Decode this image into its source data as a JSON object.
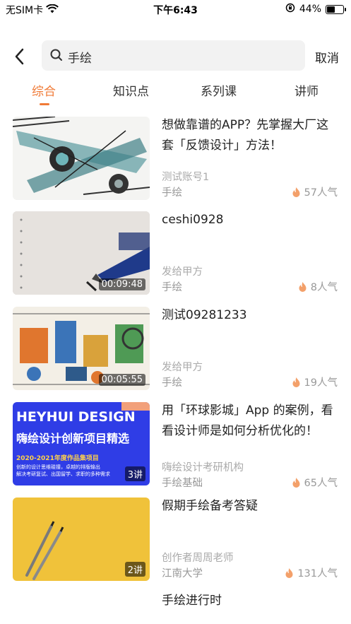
{
  "status_bar": {
    "carrier": "无SIM卡",
    "time": "下午6:43",
    "battery": "44%"
  },
  "search": {
    "query": "手绘",
    "cancel_label": "取消"
  },
  "tabs": [
    {
      "label": "综合",
      "active": true
    },
    {
      "label": "知识点",
      "active": false
    },
    {
      "label": "系列课",
      "active": false
    },
    {
      "label": "讲师",
      "active": false
    }
  ],
  "items": [
    {
      "title": "想做靠谱的APP？先掌握大厂这套「反馈设计」方法！",
      "author": "测试账号1",
      "tag": "手绘",
      "popularity": "57人气",
      "badge": ""
    },
    {
      "title": "ceshi0928",
      "author": "发给甲方",
      "tag": "手绘",
      "popularity": "8人气",
      "badge": "00:09:48"
    },
    {
      "title": "测试09281233",
      "author": "发给甲方",
      "tag": "手绘",
      "popularity": "19人气",
      "badge": "00:05:55"
    },
    {
      "title": "用「环球影城」App 的案例，看看设计师是如何分析优化的！",
      "author": "嗨绘设计考研机构",
      "tag": "手绘基础",
      "popularity": "65人气",
      "badge": "3讲",
      "thumb_text": {
        "line1": "HEYHUI DESIGN",
        "line2": "嗨绘设计创新项目精选",
        "line3": "2020-2021年度作品集项目",
        "line4": "创新的设计思维碰撞，卓越的排版输出",
        "line5": "解决考研复试、出国留学、求职的多种需求"
      }
    },
    {
      "title": "假期手绘备考答疑",
      "author": "创作者周周老师",
      "tag": "江南大学",
      "popularity": "131人气",
      "badge": "2讲"
    },
    {
      "title": "手绘进行时",
      "author": "",
      "tag": "",
      "popularity": "",
      "badge": ""
    }
  ],
  "colors": {
    "accent": "#f07a36",
    "fire": "#f3a06a"
  }
}
